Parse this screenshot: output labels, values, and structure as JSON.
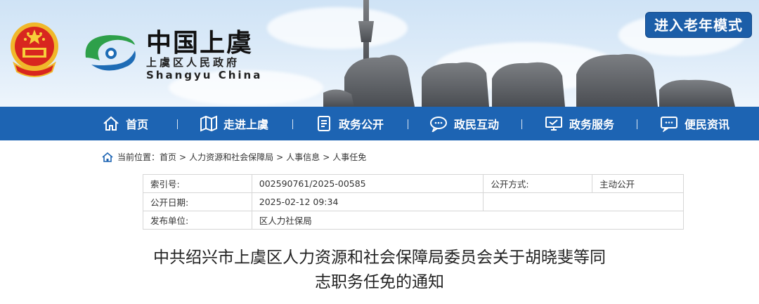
{
  "header": {
    "title_cn": "中国上虞",
    "subtitle_cn": "上虞区人民政府",
    "title_en": "Shangyu China",
    "elder_mode_label": "进入老年模式",
    "colors": {
      "nav_bg": "#1d64b3",
      "elder_btn_bg": "#1c5ea8",
      "logo_green": "#2ea04a",
      "logo_blue": "#1e6cb5"
    }
  },
  "nav": {
    "items": [
      {
        "label": "首页",
        "icon": "home-icon"
      },
      {
        "label": "走进上虞",
        "icon": "map-icon"
      },
      {
        "label": "政务公开",
        "icon": "document-icon"
      },
      {
        "label": "政民互动",
        "icon": "chat-icon"
      },
      {
        "label": "政务服务",
        "icon": "monitor-icon"
      },
      {
        "label": "便民资讯",
        "icon": "message-icon"
      }
    ]
  },
  "breadcrumb": {
    "prefix": "当前位置：",
    "items": [
      "首页",
      "人力资源和社会保障局",
      "人事信息",
      "人事任免"
    ],
    "separator": ">"
  },
  "meta": {
    "index_label": "索引号:",
    "index_value": "002590761/2025-00585",
    "open_method_label": "公开方式:",
    "open_method_value": "主动公开",
    "open_date_label": "公开日期:",
    "open_date_value": "2025-02-12 09:34",
    "publisher_label": "发布单位:",
    "publisher_value": "区人力社保局"
  },
  "document": {
    "title_line1": "中共绍兴市上虞区人力资源和社会保障局委员会关于胡晓斐等同",
    "title_line2": "志职务任免的通知"
  }
}
